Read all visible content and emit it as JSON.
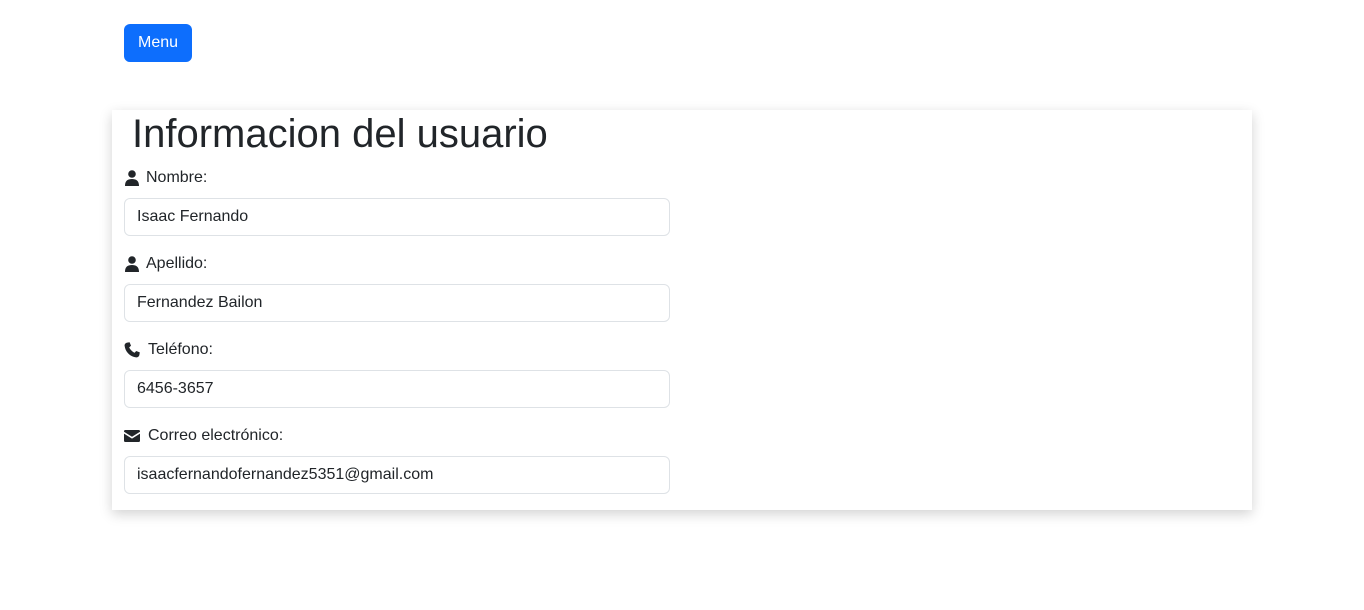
{
  "header": {
    "menu_label": "Menu"
  },
  "user_info": {
    "title": "Informacion del usuario",
    "fields": [
      {
        "label": "Nombre:",
        "icon": "user-icon",
        "value": "Isaac Fernando"
      },
      {
        "label": "Apellido:",
        "icon": "user-icon",
        "value": "Fernandez Bailon"
      },
      {
        "label": "Teléfono:",
        "icon": "phone-icon",
        "value": "6456-3657"
      },
      {
        "label": "Correo electrónico:",
        "icon": "envelope-icon",
        "value": "isaacfernandofernandez5351@gmail.com"
      }
    ]
  },
  "colors": {
    "primary": "#0d6efd",
    "text": "#212529",
    "input_border": "#dee2e6"
  }
}
